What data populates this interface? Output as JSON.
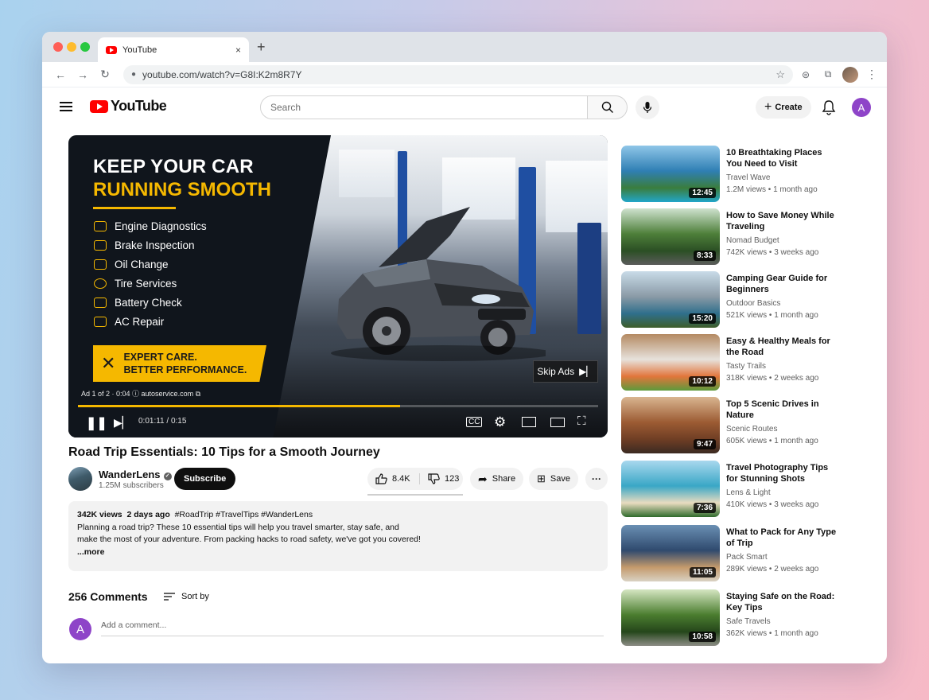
{
  "browser": {
    "tab_title": "YouTube",
    "tab_close": "×",
    "new_tab": "+",
    "url": "youtube.com/watch?v=G8I:K2m8R7Y",
    "icons": [
      "back-icon",
      "forward-icon",
      "reload-icon",
      "lock-icon",
      "star-icon",
      "extension-icon",
      "puzzle-icon",
      "profile-icon",
      "menu-icon"
    ]
  },
  "header": {
    "logo_text": "YouTube",
    "search_placeholder": "Search",
    "create_label": "Create",
    "avatar_letter": "A"
  },
  "player": {
    "ad_headline_1": "KEEP YOUR CAR",
    "ad_headline_2": "RUNNING SMOOTH",
    "services": [
      "Engine Diagnostics",
      "Brake Inspection",
      "Oil Change",
      "Tire Services",
      "Battery Check",
      "AC Repair"
    ],
    "banner_line_1": "EXPERT CARE.",
    "banner_line_2": "BETTER PERFORMANCE.",
    "skip_label": "Skip Ads",
    "ad_info": "Ad 1 of 2 · 0:04 ⓘ  autoservice.com ⧉",
    "timecode": "0:01:11 / 0:15",
    "progress": 0.62,
    "accent_color": "#f5b800"
  },
  "video": {
    "title": "Road Trip Essentials: 10 Tips for a Smooth Journey",
    "channel": "WanderLens",
    "subscribers": "1.25M subscribers",
    "subscribe_label": "Subscribe",
    "likes": "8.4K",
    "dislikes": "123",
    "share_label": "Share",
    "save_label": "Save",
    "more_label": "···",
    "views": "342K views",
    "age": "2 days ago",
    "hashtags": "#RoadTrip #TravelTips #WanderLens",
    "description_1": "Planning a road trip? These 10 essential tips will help you travel smarter, stay safe, and",
    "description_2": "make the most of your adventure. From packing hacks to road safety, we've got you covered!",
    "more_link": "...more"
  },
  "comments": {
    "count_label": "256 Comments",
    "sort_label": "Sort by",
    "avatar_letter": "A",
    "placeholder": "Add a comment..."
  },
  "recommendations": [
    {
      "title": "10 Breathtaking Places You Need to Visit",
      "channel": "Travel Wave",
      "views": "1.2M views",
      "age": "1 month ago",
      "duration": "12:45",
      "palette": [
        "#8fc6e8",
        "#2f7fb4",
        "#3a7d3d",
        "#22a6c9"
      ]
    },
    {
      "title": "How to Save Money While Traveling",
      "channel": "Nomad Budget",
      "views": "742K views",
      "age": "3 weeks ago",
      "duration": "8:33",
      "palette": [
        "#cfe2cf",
        "#4e7f3a",
        "#2b4f24",
        "#5c5c5c"
      ]
    },
    {
      "title": "Camping Gear Guide for Beginners",
      "channel": "Outdoor Basics",
      "views": "521K views",
      "age": "1 month ago",
      "duration": "15:20",
      "palette": [
        "#c9dbe8",
        "#8a9aa6",
        "#2f6f8c",
        "#3e5e2a"
      ]
    },
    {
      "title": "Easy & Healthy Meals for the Road",
      "channel": "Tasty Trails",
      "views": "318K views",
      "age": "2 weeks ago",
      "duration": "10:12",
      "palette": [
        "#b48a62",
        "#e7e2dc",
        "#e2753b",
        "#5c9a3b"
      ]
    },
    {
      "title": "Top 5 Scenic Drives in Nature",
      "channel": "Scenic Routes",
      "views": "605K views",
      "age": "1 month ago",
      "duration": "9:47",
      "palette": [
        "#d9b590",
        "#9c5b33",
        "#6f3e24",
        "#3b2a22"
      ]
    },
    {
      "title": "Travel Photography Tips for Stunning Shots",
      "channel": "Lens & Light",
      "views": "410K views",
      "age": "3 weeks ago",
      "duration": "7:36",
      "palette": [
        "#a9d8ee",
        "#39a7c6",
        "#e9dcc0",
        "#2f6b2c"
      ]
    },
    {
      "title": "What to Pack for Any Type of Trip",
      "channel": "Pack Smart",
      "views": "289K views",
      "age": "2 weeks ago",
      "duration": "11:05",
      "palette": [
        "#6a8fb3",
        "#2f4a6e",
        "#c49a6c",
        "#d9d2c3"
      ]
    },
    {
      "title": "Staying Safe on the Road: Key Tips",
      "channel": "Safe Travels",
      "views": "362K views",
      "age": "1 month ago",
      "duration": "10:58",
      "palette": [
        "#d5e6c2",
        "#4b7d2f",
        "#25461b",
        "#8d8d86"
      ]
    }
  ]
}
